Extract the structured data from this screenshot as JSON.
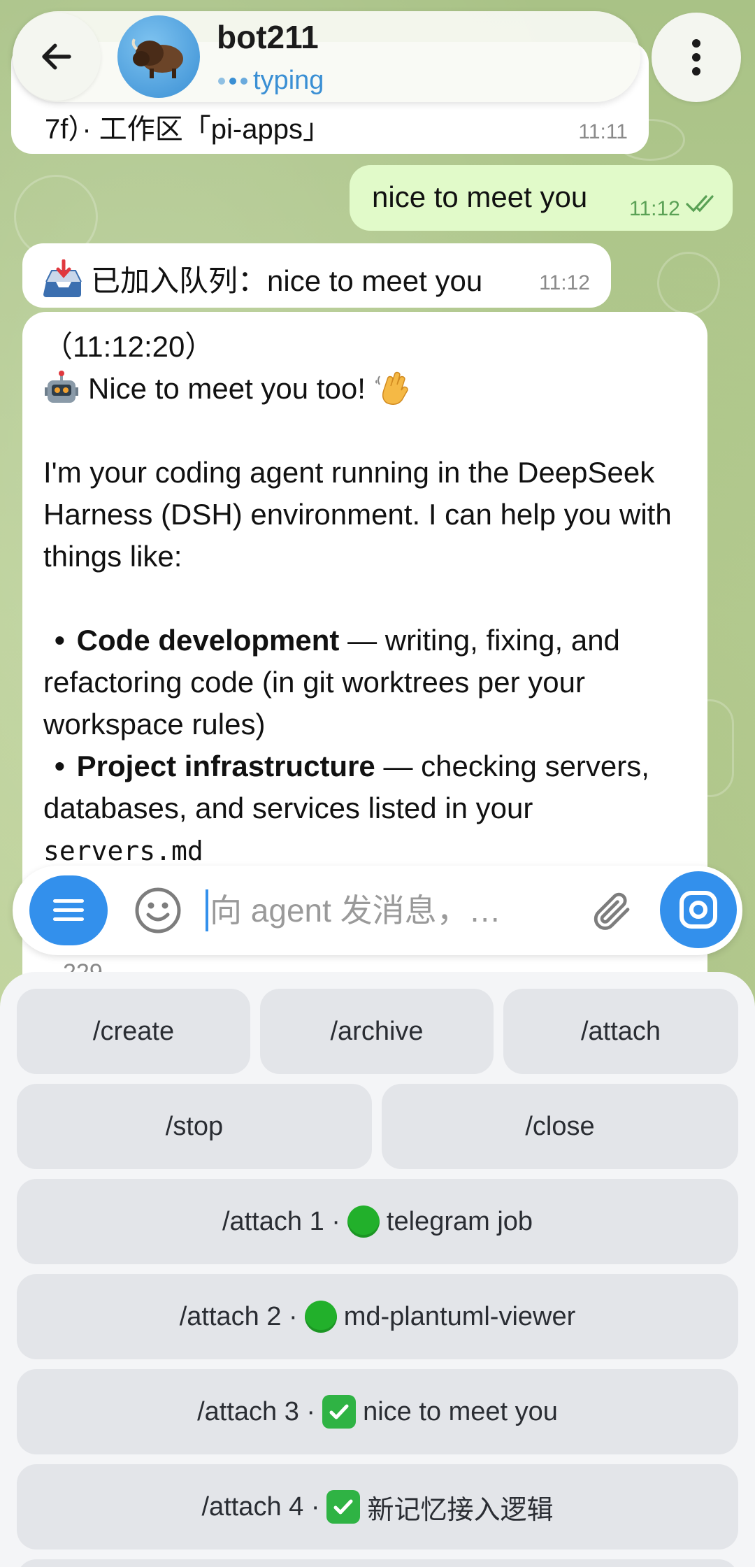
{
  "header": {
    "title": "bot211",
    "status": "typing"
  },
  "messages": {
    "prev_text": "7f）· 工作区「pi-apps」",
    "prev_time": "11:11",
    "out_text": "nice to meet you",
    "out_time": "11:12",
    "queue_text": "已加入队列：nice to meet you",
    "queue_time": "11:12",
    "main": {
      "timestamp": "（11:12:20）",
      "greeting": "Nice to meet you too!",
      "intro": "I'm your coding agent running in the DeepSeek Harness (DSH) environment. I can help you with things like:",
      "b1_title": "Code development",
      "b1_text": " — writing, fixing, and refactoring code (in git worktrees per your workspace rules)",
      "b2_title": "Project infrastructure",
      "b2_text": " — checking servers, databases, and services listed in your ",
      "b2_code": "servers.md"
    }
  },
  "input": {
    "placeholder": "向 agent 发消息，…"
  },
  "keyboard": {
    "partial": "229",
    "create": "/create",
    "archive": "/archive",
    "attach": "/attach",
    "stop": "/stop",
    "close": "/close",
    "attach1": "/attach 1 · ",
    "attach1_name": "telegram job",
    "attach2": "/attach 2 · ",
    "attach2_name": "md-plantuml-viewer",
    "attach3": "/attach 3 · ",
    "attach3_name": "nice to meet you",
    "attach4": "/attach 4 · ",
    "attach4_name": "新记忆接入逻辑"
  },
  "colors": {
    "accent": "#3390ec",
    "outgoing_bubble": "#e1fac9",
    "green_status": "#22b02b"
  }
}
